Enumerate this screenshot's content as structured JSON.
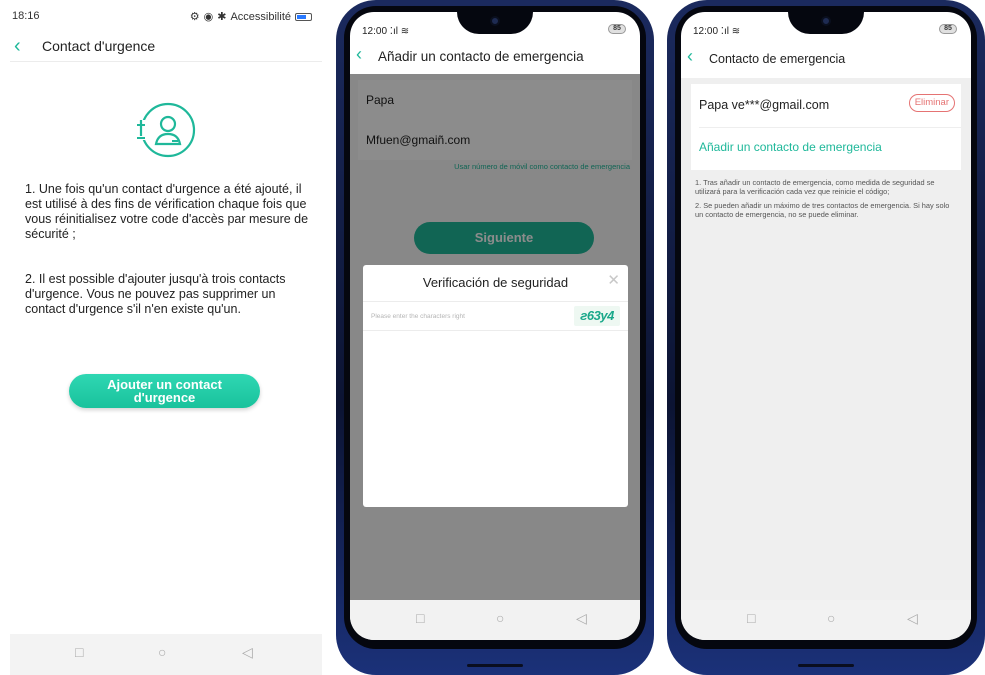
{
  "screen1": {
    "status": {
      "time": "18:16",
      "accessibility": "Accessibilité"
    },
    "header": {
      "title": "Contact d'urgence"
    },
    "paragraph1": "1. Une fois qu'un contact d'urgence a été ajouté, il est utilisé à des fins de vérification chaque fois que vous réinitialisez votre code d'accès par mesure de sécurité ;",
    "paragraph2": "2. Il est possible d'ajouter jusqu'à trois contacts d'urgence. Vous ne pouvez pas supprimer un contact d'urgence s'il n'en existe qu'un.",
    "button": "Ajouter un contact d'urgence"
  },
  "screen2": {
    "status": {
      "time": "12:00",
      "battery": "85"
    },
    "header": {
      "title": "Añadir un contacto de emergencia"
    },
    "name_value": "Papa",
    "email_value": "Mfuen@gmaiñ.com",
    "link": "Usar número de móvil como contacto de emergencia",
    "next_button": "Siguiente",
    "dialog": {
      "title": "Verificación de seguridad",
      "placeholder": "Please enter the characters right",
      "captcha": "ƨ63y4"
    }
  },
  "screen3": {
    "status": {
      "time": "12:00",
      "battery": "85"
    },
    "header": {
      "title": "Contacto de emergencia"
    },
    "contact": "Papa ve***@gmail.com",
    "delete_button": "Eliminar",
    "add_link": "Añadir un contacto de emergencia",
    "note1": "1. Tras añadir un contacto de emergencia, como medida de seguridad se utilizará para la verificación cada vez que reinicie el código;",
    "note2": "2. Se pueden añadir un máximo de tres contactos de emergencia. Si hay solo un contacto de emergencia, no se puede eliminar."
  },
  "colors": {
    "accent": "#1fb89a",
    "danger": "#e57373"
  }
}
